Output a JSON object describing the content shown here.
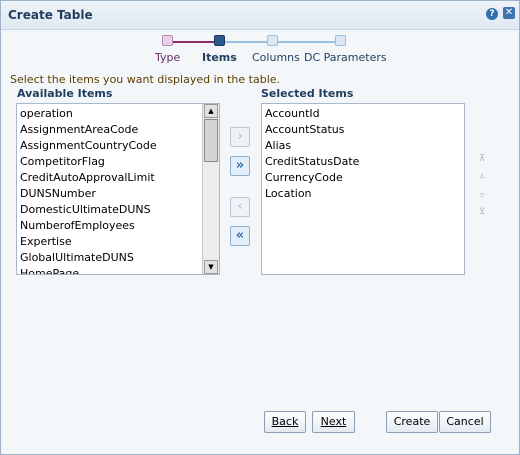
{
  "window": {
    "title": "Create Table"
  },
  "train": {
    "steps": [
      {
        "label": "Type",
        "state": "visited"
      },
      {
        "label": "Items",
        "state": "current"
      },
      {
        "label": "Columns",
        "state": "todo"
      },
      {
        "label": "DC Parameters",
        "state": "todo"
      }
    ]
  },
  "instruction": "Select the items you want displayed in the table.",
  "available": {
    "header": "Available Items",
    "items": [
      "operation",
      "AssignmentAreaCode",
      "AssignmentCountryCode",
      "CompetitorFlag",
      "CreditAutoApprovalLimit",
      "DUNSNumber",
      "DomesticUltimateDUNS",
      "NumberofEmployees",
      "Expertise",
      "GlobalUltimateDUNS",
      "HomePage"
    ]
  },
  "selected": {
    "header": "Selected Items",
    "items": [
      "AccountId",
      "AccountStatus",
      "Alias",
      "CreditStatusDate",
      "CurrencyCode",
      "Location"
    ]
  },
  "shuttle": {
    "move": "›",
    "move_all": "»",
    "remove": "‹",
    "remove_all": "«"
  },
  "buttons": {
    "back": "Back",
    "next": "Next",
    "create": "Create",
    "cancel": "Cancel"
  },
  "colors": {
    "title": "#1f3d5c",
    "accent": "#2f6fb0",
    "visited": "#8a2b6d"
  }
}
